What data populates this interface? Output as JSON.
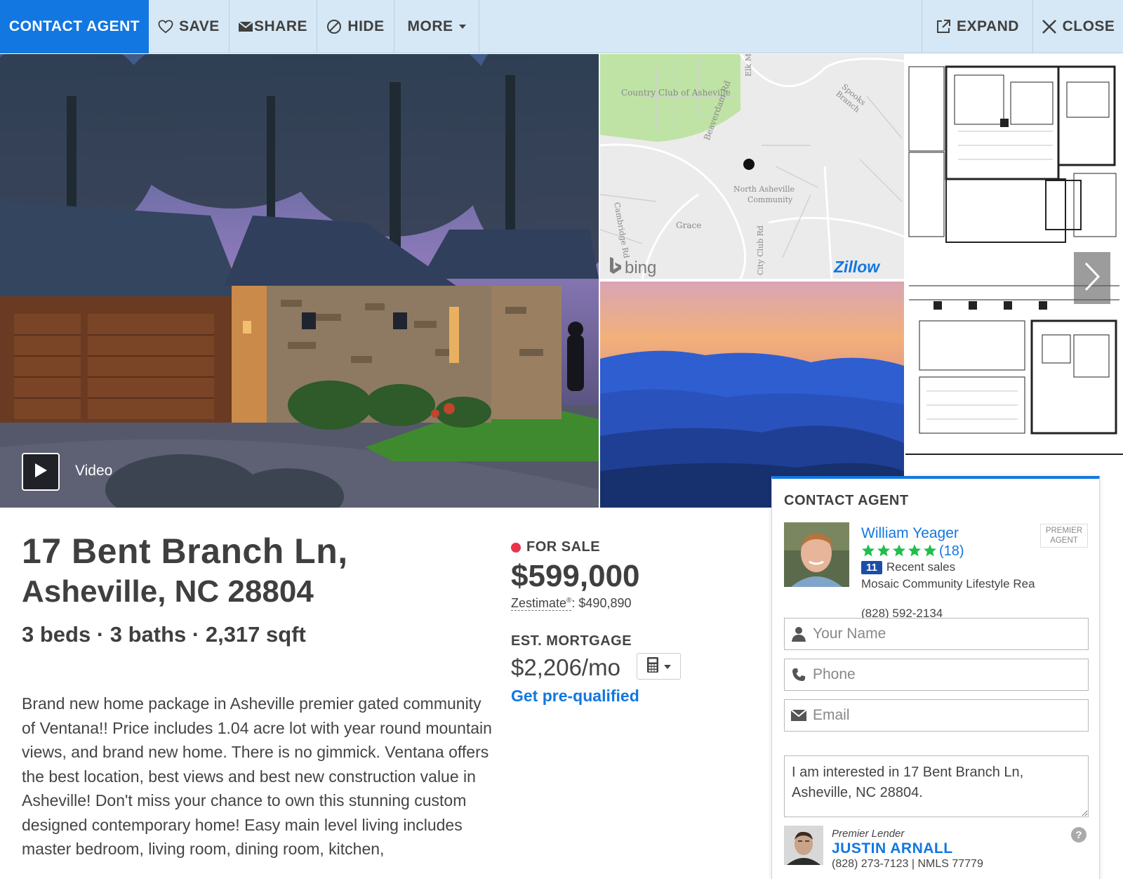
{
  "toolbar": {
    "contact_agent": "CONTACT AGENT",
    "save": "SAVE",
    "share": "SHARE",
    "hide": "HIDE",
    "more": "MORE",
    "expand": "EXPAND",
    "close": "CLOSE"
  },
  "gallery": {
    "video_label": "Video",
    "map_labels": {
      "country_club": "Country Club of Asheville",
      "beaverdam": "Beaverdam Rd",
      "north_asheville_1": "North Asheville",
      "north_asheville_2": "Community",
      "grace": "Grace",
      "elk": "Elk M",
      "spooks": "Spooks Branch",
      "cambridge": "Cambridge Rd",
      "city_club": "City Club Rd"
    },
    "bing": "bing",
    "zillow": "Zillow"
  },
  "listing": {
    "address_line1": "17 Bent Branch Ln,",
    "address_line2": "Asheville, NC 28804",
    "facts": "3 beds · 3 baths · 2,317 sqft",
    "description": "Brand new home package in Asheville premier gated community of Ventana!! Price includes 1.04 acre lot with year round mountain views, and brand new home. There is no gimmick. Ventana offers the best location, best views and best new construction value in Asheville! Don't miss your chance to own this stunning custom designed contemporary home! Easy main level living includes master bedroom, living room, dining room, kitchen,",
    "status": "FOR SALE",
    "price": "$599,000",
    "zestimate_label": "Zestimate",
    "zestimate_mark": "®",
    "zestimate_value": ": $490,890",
    "mortgage_label": "EST. MORTGAGE",
    "mortgage_value": "$2,206/mo",
    "prequalified": "Get pre-qualified"
  },
  "contact": {
    "title": "CONTACT AGENT",
    "agent_name": "William Yeager",
    "premier_line1": "PREMIER",
    "premier_line2": "AGENT",
    "rating_stars": 5,
    "reviews": "(18)",
    "recent_sales_count": "11",
    "recent_sales_label": "Recent sales",
    "company": "Mosaic Community Lifestyle Rea",
    "phone": "(828) 592-2134",
    "name_placeholder": "Your Name",
    "phone_placeholder": "Phone",
    "email_placeholder": "Email",
    "message": "I am interested in 17 Bent Branch Ln, Asheville, NC 28804.",
    "lender_role": "Premier Lender",
    "lender_name": "JUSTIN ARNALL",
    "lender_info": "(828) 273-7123 | NMLS 77779",
    "help": "?"
  },
  "colors": {
    "brand_blue": "#1277e1",
    "toolbar_bg": "#d6e8f5",
    "status_red": "#e9334a",
    "star_green": "#1fbf4a"
  }
}
